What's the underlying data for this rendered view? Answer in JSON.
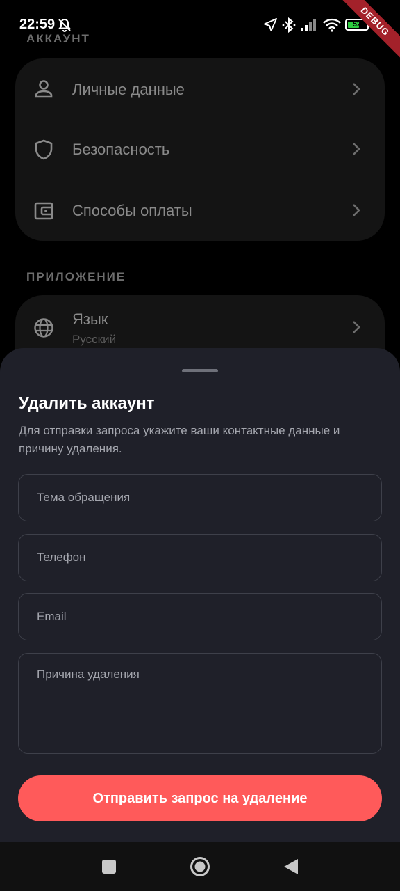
{
  "status_bar": {
    "time": "22:59",
    "battery_level": "52",
    "debug_label": "DEBUG",
    "icons": [
      "bell-off-icon",
      "location-arrow-icon",
      "bluetooth-icon",
      "signal-icon",
      "wifi-icon",
      "battery-icon"
    ]
  },
  "settings": {
    "account_section_label": "АККАУНТ",
    "account_items": [
      {
        "label": "Личные данные",
        "icon": "person-icon"
      },
      {
        "label": "Безопасность",
        "icon": "shield-icon"
      },
      {
        "label": "Способы оплаты",
        "icon": "wallet-icon"
      }
    ],
    "app_section_label": "ПРИЛОЖЕНИЕ",
    "language": {
      "label": "Язык",
      "value": "Русский",
      "icon": "globe-icon"
    }
  },
  "sheet": {
    "title": "Удалить аккаунт",
    "description": "Для отправки запроса укажите ваши контактные данные и причину удаления.",
    "fields": {
      "subject_placeholder": "Тема обращения",
      "phone_placeholder": "Телефон",
      "email_placeholder": "Email",
      "reason_placeholder": "Причина удаления"
    },
    "submit_label": "Отправить запрос на удаление"
  },
  "navigation": {
    "icons": [
      "recents-icon",
      "home-icon",
      "back-icon"
    ]
  },
  "colors": {
    "accent": "#ff5a5a",
    "sheet_background": "#1f2029",
    "page_background": "#000000"
  }
}
